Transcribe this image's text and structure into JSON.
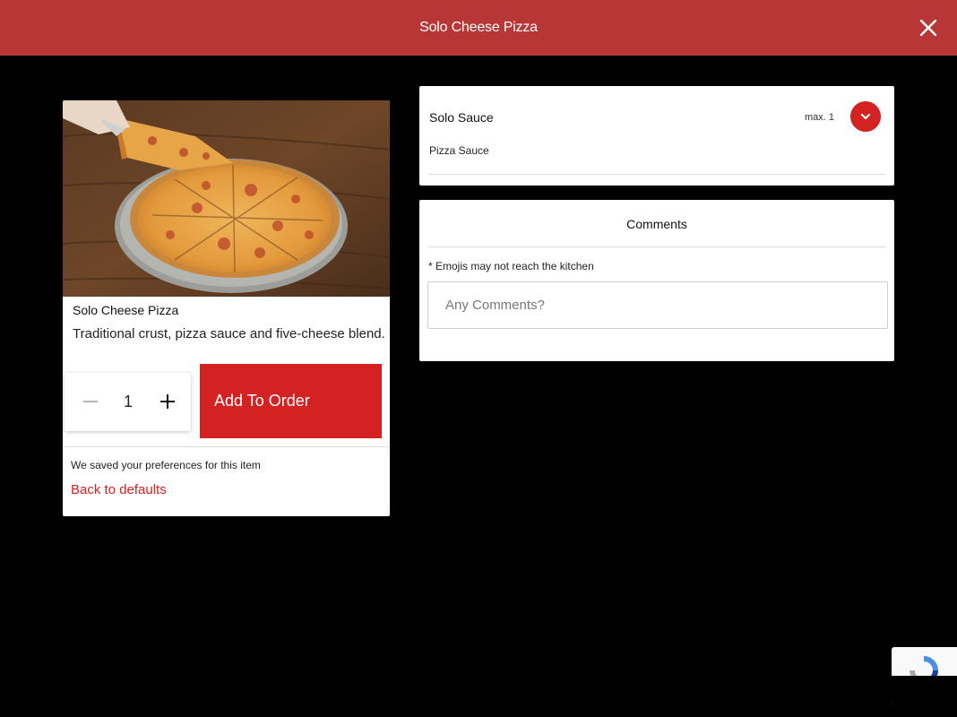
{
  "header": {
    "title": "Solo Cheese Pizza",
    "close_icon": "close-icon"
  },
  "item": {
    "image_icon": "pizza-photo",
    "name": "Solo Cheese Pizza",
    "description": "Traditional crust, pizza sauce and five-cheese blend.",
    "quantity": "1",
    "minus_icon": "minus-icon",
    "plus_icon": "plus-icon",
    "add_button": "Add To Order",
    "saved_note": "We saved your preferences for this item",
    "back_link": "Back to defaults"
  },
  "sauce": {
    "title": "Solo Sauce",
    "max_label": "max. 1",
    "toggle_icon": "chevron-down-icon",
    "selected_option": "Pizza Sauce"
  },
  "comments": {
    "title": "Comments",
    "note": "* Emojis may not reach the kitchen",
    "placeholder": "Any Comments?",
    "value": ""
  },
  "colors": {
    "header_bg": "#b83636",
    "accent": "#d42121",
    "background": "#000000",
    "card": "#ffffff"
  }
}
